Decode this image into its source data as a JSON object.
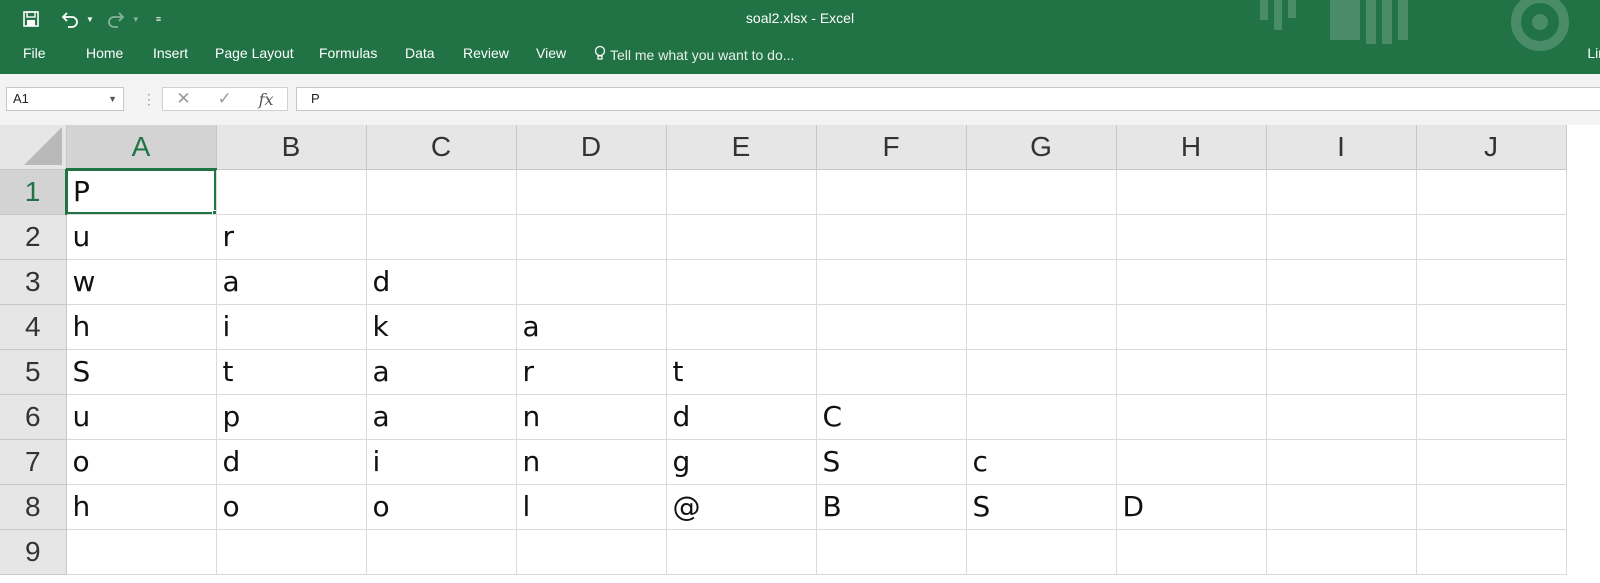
{
  "window": {
    "title": "soal2.xlsx - Excel",
    "user_partial": "Lin"
  },
  "qat": {
    "save_icon": "save-icon",
    "undo_icon": "undo-icon",
    "redo_icon": "redo-icon",
    "customize_icon": "customize-qat-icon"
  },
  "ribbon": {
    "tabs": [
      "File",
      "Home",
      "Insert",
      "Page Layout",
      "Formulas",
      "Data",
      "Review",
      "View"
    ],
    "tell_me": "Tell me what you want to do..."
  },
  "formula_bar": {
    "name_box": "A1",
    "cancel": "✕",
    "enter": "✓",
    "fx": "fx",
    "content": "P"
  },
  "sheet": {
    "columns": [
      "A",
      "B",
      "C",
      "D",
      "E",
      "F",
      "G",
      "H",
      "I",
      "J"
    ],
    "rows": [
      {
        "num": "1",
        "cells": [
          "P",
          "",
          "",
          "",
          "",
          "",
          "",
          "",
          "",
          ""
        ]
      },
      {
        "num": "2",
        "cells": [
          "u",
          "r",
          "",
          "",
          "",
          "",
          "",
          "",
          "",
          ""
        ]
      },
      {
        "num": "3",
        "cells": [
          "w",
          "a",
          "d",
          "",
          "",
          "",
          "",
          "",
          "",
          ""
        ]
      },
      {
        "num": "4",
        "cells": [
          "h",
          "i",
          "k",
          "a",
          "",
          "",
          "",
          "",
          "",
          ""
        ]
      },
      {
        "num": "5",
        "cells": [
          "S",
          "t",
          "a",
          "r",
          "t",
          "",
          "",
          "",
          "",
          ""
        ]
      },
      {
        "num": "6",
        "cells": [
          "u",
          "p",
          "a",
          "n",
          "d",
          "C",
          "",
          "",
          "",
          ""
        ]
      },
      {
        "num": "7",
        "cells": [
          "o",
          "d",
          "i",
          "n",
          "g",
          "S",
          "c",
          "",
          "",
          ""
        ]
      },
      {
        "num": "8",
        "cells": [
          "h",
          "o",
          "o",
          "l",
          "@",
          "B",
          "S",
          "D",
          "",
          ""
        ]
      },
      {
        "num": "9",
        "cells": [
          "",
          "",
          "",
          "",
          "",
          "",
          "",
          "",
          "",
          ""
        ]
      }
    ],
    "selected_cell": "A1"
  },
  "colors": {
    "accent": "#217346",
    "header_bg": "#e6e6e6",
    "gridline": "#dadada"
  }
}
